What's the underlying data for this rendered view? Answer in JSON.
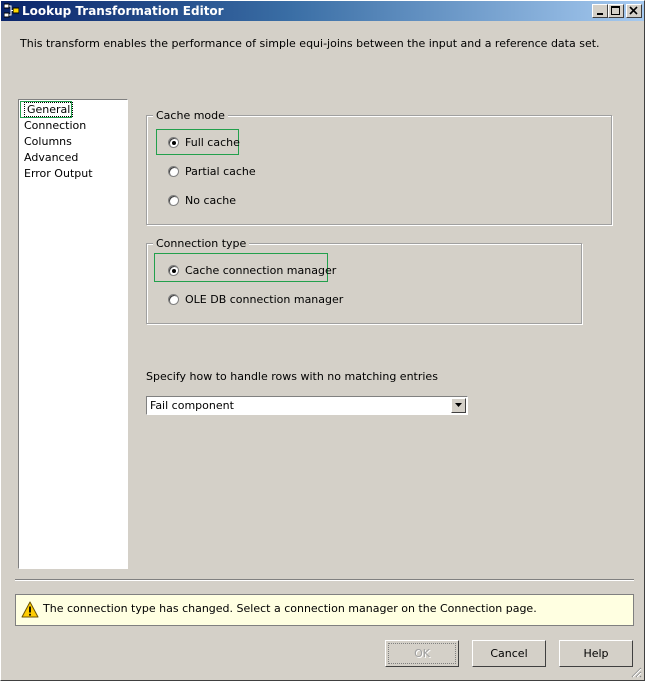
{
  "window": {
    "title": "Lookup Transformation Editor",
    "description": "This transform enables the performance of simple equi-joins between the input and a reference data set."
  },
  "nav": {
    "items": [
      {
        "label": "General",
        "selected": true
      },
      {
        "label": "Connection"
      },
      {
        "label": "Columns"
      },
      {
        "label": "Advanced"
      },
      {
        "label": "Error Output"
      }
    ]
  },
  "cache_mode": {
    "legend": "Cache mode",
    "options": [
      {
        "label": "Full cache",
        "checked": true
      },
      {
        "label": "Partial cache",
        "checked": false
      },
      {
        "label": "No cache",
        "checked": false
      }
    ]
  },
  "connection_type": {
    "legend": "Connection type",
    "options": [
      {
        "label": "Cache connection manager",
        "checked": true
      },
      {
        "label": "OLE DB connection manager",
        "checked": false
      }
    ]
  },
  "no_match": {
    "prompt": "Specify how to handle rows with no matching entries",
    "selected": "Fail component"
  },
  "message": {
    "text": "The connection type has changed. Select a connection manager on the Connection page.",
    "icon": "warning-icon"
  },
  "buttons": {
    "ok": "OK",
    "cancel": "Cancel",
    "help": "Help"
  },
  "colors": {
    "highlight": "#22a04c",
    "message_bg": "#ffffe1"
  }
}
